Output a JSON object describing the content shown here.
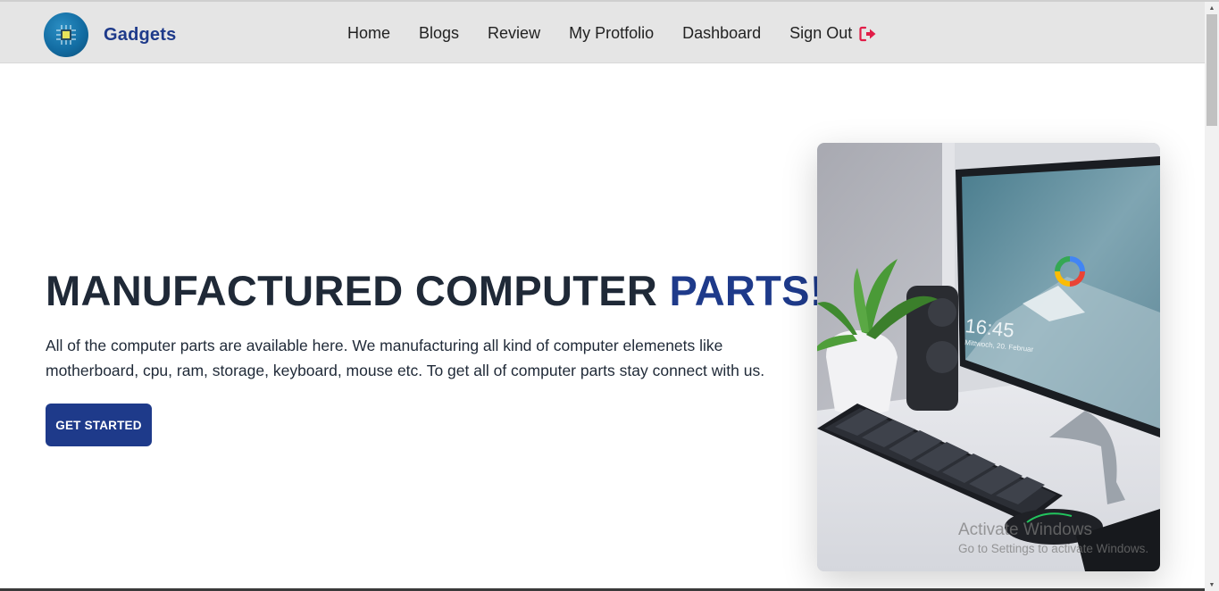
{
  "navbar": {
    "brand": "Gadgets",
    "links": [
      "Home",
      "Blogs",
      "Review",
      "My Protfolio",
      "Dashboard"
    ],
    "signout_label": "Sign Out",
    "signout_icon": "sign-out-icon",
    "colors": {
      "background": "#e5e5e5",
      "brand": "#1e3a8a",
      "signout_icon": "#e11d48"
    }
  },
  "hero": {
    "title_main": "MANUFACTURED COMPUTER",
    "title_accent": "PARTS!",
    "description": "All of the computer parts are available here. We manufacturing all kind of computer elemenets like motherboard, cpu, ram, storage, keyboard, mouse etc. To get all of computer parts stay connect with us.",
    "cta_label": "GET STARTED",
    "image_clock": "16:45",
    "image_date": "Mittwoch, 20. Februar",
    "colors": {
      "accent": "#1e3a8a",
      "text": "#1f2937"
    }
  },
  "watermark": {
    "title": "Activate Windows",
    "subtitle": "Go to Settings to activate Windows."
  }
}
